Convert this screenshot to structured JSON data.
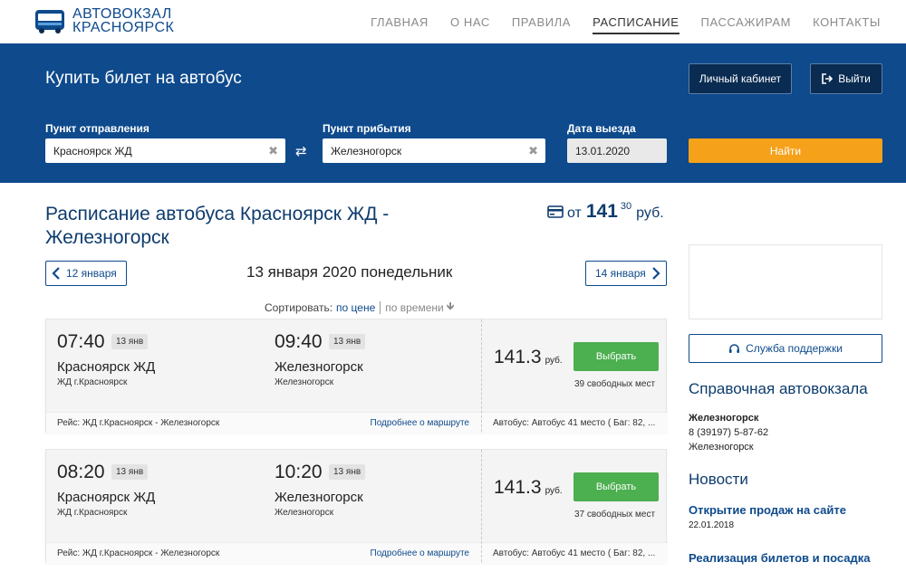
{
  "header": {
    "logo_line1": "АВТОВОКЗАЛ",
    "logo_line2": "КРАСНОЯРСК",
    "menu": [
      "ГЛАВНАЯ",
      "О НАС",
      "ПРАВИЛА",
      "РАСПИСАНИЕ",
      "ПАССАЖИРАМ",
      "КОНТАКТЫ"
    ],
    "active_menu": "РАСПИСАНИЕ"
  },
  "booking": {
    "title": "Купить билет на автобус",
    "cabinet_label": "Личный кабинет",
    "exit_label": "Выйти",
    "from_label": "Пункт отправления",
    "from_value": "Красноярск ЖД",
    "to_label": "Пункт прибытия",
    "to_value": "Железногорск",
    "date_label": "Дата выезда",
    "date_value": "13.01.2020",
    "find_label": "Найти"
  },
  "schedule": {
    "title": "Расписание автобуса Красноярск ЖД - Железногорск",
    "price_from_label": "от",
    "price_from_int": "141",
    "price_from_dec": "30",
    "price_from_currency": "руб.",
    "prev_date": "12 января",
    "current_date": "13 января 2020 понедельник",
    "next_date": "14 января",
    "sort_label": "Сортировать:",
    "sort_price": "по цене",
    "sort_time": "по времени"
  },
  "trips": [
    {
      "dep_time": "07:40",
      "dep_day": "13 янв",
      "dep_city": "Красноярск ЖД",
      "dep_stop": "ЖД г.Красноярск",
      "arr_time": "09:40",
      "arr_day": "13 янв",
      "arr_city": "Железногорск",
      "arr_stop": "Железногорск",
      "route": "Рейс: ЖД г.Красноярск - Железногорск",
      "more": "Подробнее о маршруте",
      "price": "141.3",
      "currency": "руб.",
      "choose": "Выбрать",
      "seats": "39 свободных мест",
      "bus": "Автобус: Автобус 41 место ( Баг: 82, ..."
    },
    {
      "dep_time": "08:20",
      "dep_day": "13 янв",
      "dep_city": "Красноярск ЖД",
      "dep_stop": "ЖД г.Красноярск",
      "arr_time": "10:20",
      "arr_day": "13 янв",
      "arr_city": "Железногорск",
      "arr_stop": "Железногорск",
      "route": "Рейс: ЖД г.Красноярск - Железногорск",
      "more": "Подробнее о маршруте",
      "price": "141.3",
      "currency": "руб.",
      "choose": "Выбрать",
      "seats": "37 свободных мест",
      "bus": "Автобус: Автобус 41 место ( Баг: 82, ..."
    }
  ],
  "sidebar": {
    "support_label": "Служба поддержки",
    "info_title": "Справочная автовокзала",
    "info_city": "Железногорск",
    "info_phone": "8 (39197) 5-87-62",
    "info_place": "Железногорск",
    "news_title": "Новости",
    "news": [
      {
        "title": "Открытие продаж на сайте",
        "date": "22.01.2018"
      },
      {
        "title": "Реализация билетов и посадка"
      }
    ]
  },
  "colors": {
    "brand_blue": "#0e4a8c",
    "accent_orange": "#f5a11a",
    "choose_green": "#4caf50"
  }
}
